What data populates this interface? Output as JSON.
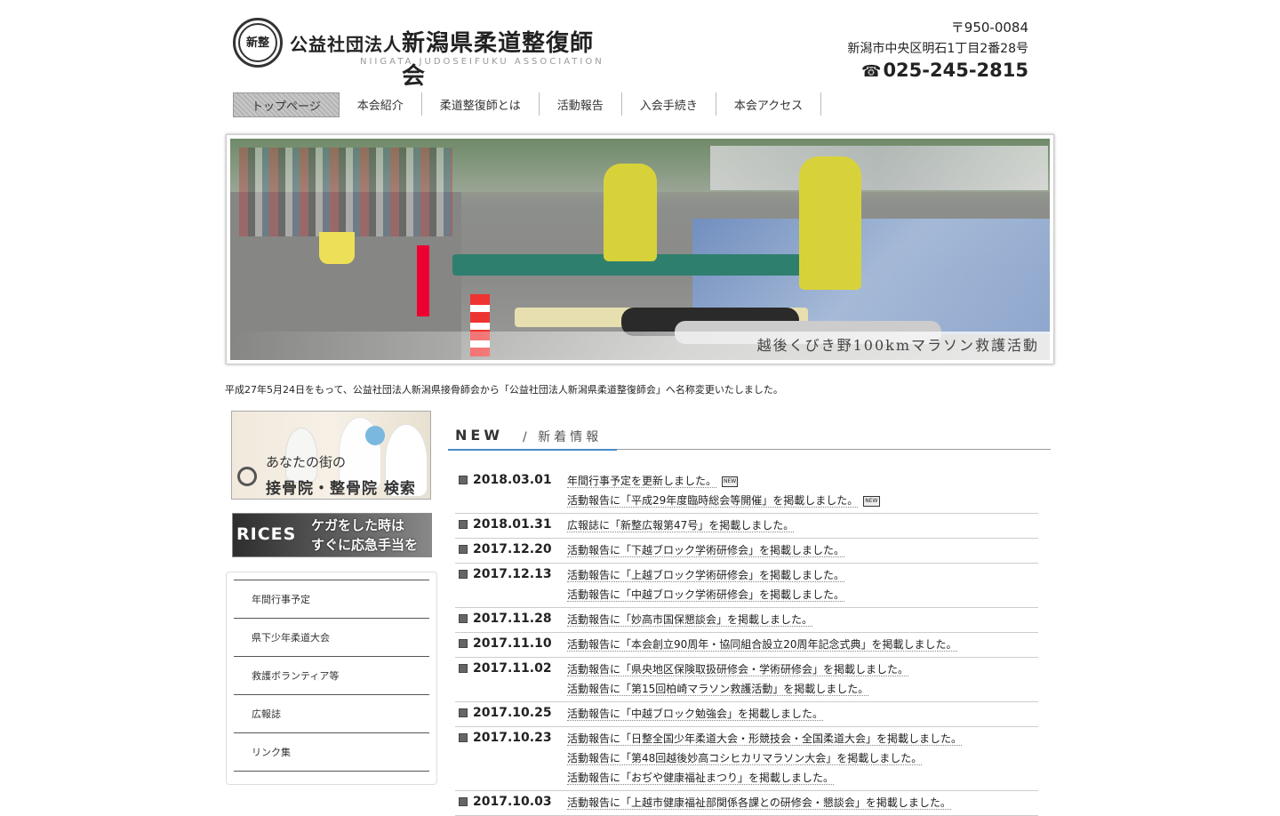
{
  "header": {
    "seal_text": "新整",
    "org_prefix": "公益社団法人",
    "org_main": "新潟県柔道整復師会",
    "org_en": "NIIGATA JUDOSEIFUKU ASSOCIATION",
    "zip": "〒950-0084",
    "address": "新潟市中央区明石1丁目2番28号",
    "tel": "025-245-2815",
    "tel_icon": "phone-icon"
  },
  "nav": [
    {
      "label": "トップページ",
      "active": true
    },
    {
      "label": "本会紹介"
    },
    {
      "label": "柔道整復師とは"
    },
    {
      "label": "活動報告"
    },
    {
      "label": "入会手続き"
    },
    {
      "label": "本会アクセス"
    }
  ],
  "hero": {
    "caption": "越後くびき野100kmマラソン救護活動"
  },
  "notice": "平成27年5月24日をもって、公益社団法人新潟県接骨師会から「公益社団法人新潟県柔道整復師会」へ名称変更いたしました。",
  "sidebar": {
    "banner1": {
      "line1": "あなたの街の",
      "line2": "接骨院・整骨院 検索"
    },
    "banner2": {
      "title": "RICES",
      "line1": "ケガをした時は",
      "line2": "すぐに応急手当を"
    },
    "menu": [
      "年間行事予定",
      "県下少年柔道大会",
      "救護ボランティア等",
      "広報誌",
      "リンク集"
    ]
  },
  "news": {
    "title": "NEW",
    "subtitle": "/ 新着情報",
    "new_badge": "NEW",
    "entries": [
      {
        "date": "2018.03.01",
        "items": [
          {
            "text": "年間行事予定を更新しました。",
            "new": true
          },
          {
            "text": "活動報告に「平成29年度臨時総会等開催」を掲載しました。",
            "new": true
          }
        ]
      },
      {
        "date": "2018.01.31",
        "items": [
          {
            "text": "広報誌に「新整広報第47号」を掲載しました。"
          }
        ]
      },
      {
        "date": "2017.12.20",
        "items": [
          {
            "text": "活動報告に「下越ブロック学術研修会」を掲載しました。"
          }
        ]
      },
      {
        "date": "2017.12.13",
        "items": [
          {
            "text": "活動報告に「上越ブロック学術研修会」を掲載しました。"
          },
          {
            "text": "活動報告に「中越ブロック学術研修会」を掲載しました。"
          }
        ]
      },
      {
        "date": "2017.11.28",
        "items": [
          {
            "text": "活動報告に「妙高市国保懇談会」を掲載しました。"
          }
        ]
      },
      {
        "date": "2017.11.10",
        "items": [
          {
            "text": "活動報告に「本会創立90周年・協同組合設立20周年記念式典」を掲載しました。"
          }
        ]
      },
      {
        "date": "2017.11.02",
        "items": [
          {
            "text": "活動報告に「県央地区保険取扱研修会・学術研修会」を掲載しました。"
          },
          {
            "text": "活動報告に「第15回柏崎マラソン救護活動」を掲載しました。"
          }
        ]
      },
      {
        "date": "2017.10.25",
        "items": [
          {
            "text": "活動報告に「中越ブロック勉強会」を掲載しました。"
          }
        ]
      },
      {
        "date": "2017.10.23",
        "items": [
          {
            "text": "活動報告に「日整全国少年柔道大会・形競技会・全国柔道大会」を掲載しました。"
          },
          {
            "text": "活動報告に「第48回越後妙高コシヒカリマラソン大会」を掲載しました。"
          },
          {
            "text": "活動報告に「おぢや健康福祉まつり」を掲載しました。"
          }
        ]
      },
      {
        "date": "2017.10.03",
        "items": [
          {
            "text": "活動報告に「上越市健康福祉部関係各課との研修会・懇談会」を掲載しました。"
          }
        ]
      }
    ]
  }
}
